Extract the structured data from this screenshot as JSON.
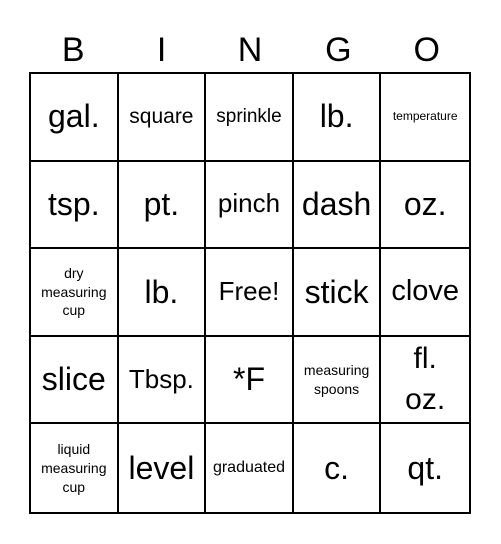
{
  "header": {
    "letters": [
      "B",
      "I",
      "N",
      "G",
      "O"
    ]
  },
  "card": {
    "cells": [
      "gal.",
      "square",
      "sprinkle",
      "lb.",
      "temperature",
      "tsp.",
      "pt.",
      "pinch",
      "dash",
      "oz.",
      "dry measuring cup",
      "lb.",
      "Free!",
      "stick",
      "clove",
      "slice",
      "Tbsp.",
      "*F",
      "measuring spoons",
      "fl. oz.",
      "liquid measuring cup",
      "level",
      "graduated",
      "c.",
      "qt."
    ]
  }
}
